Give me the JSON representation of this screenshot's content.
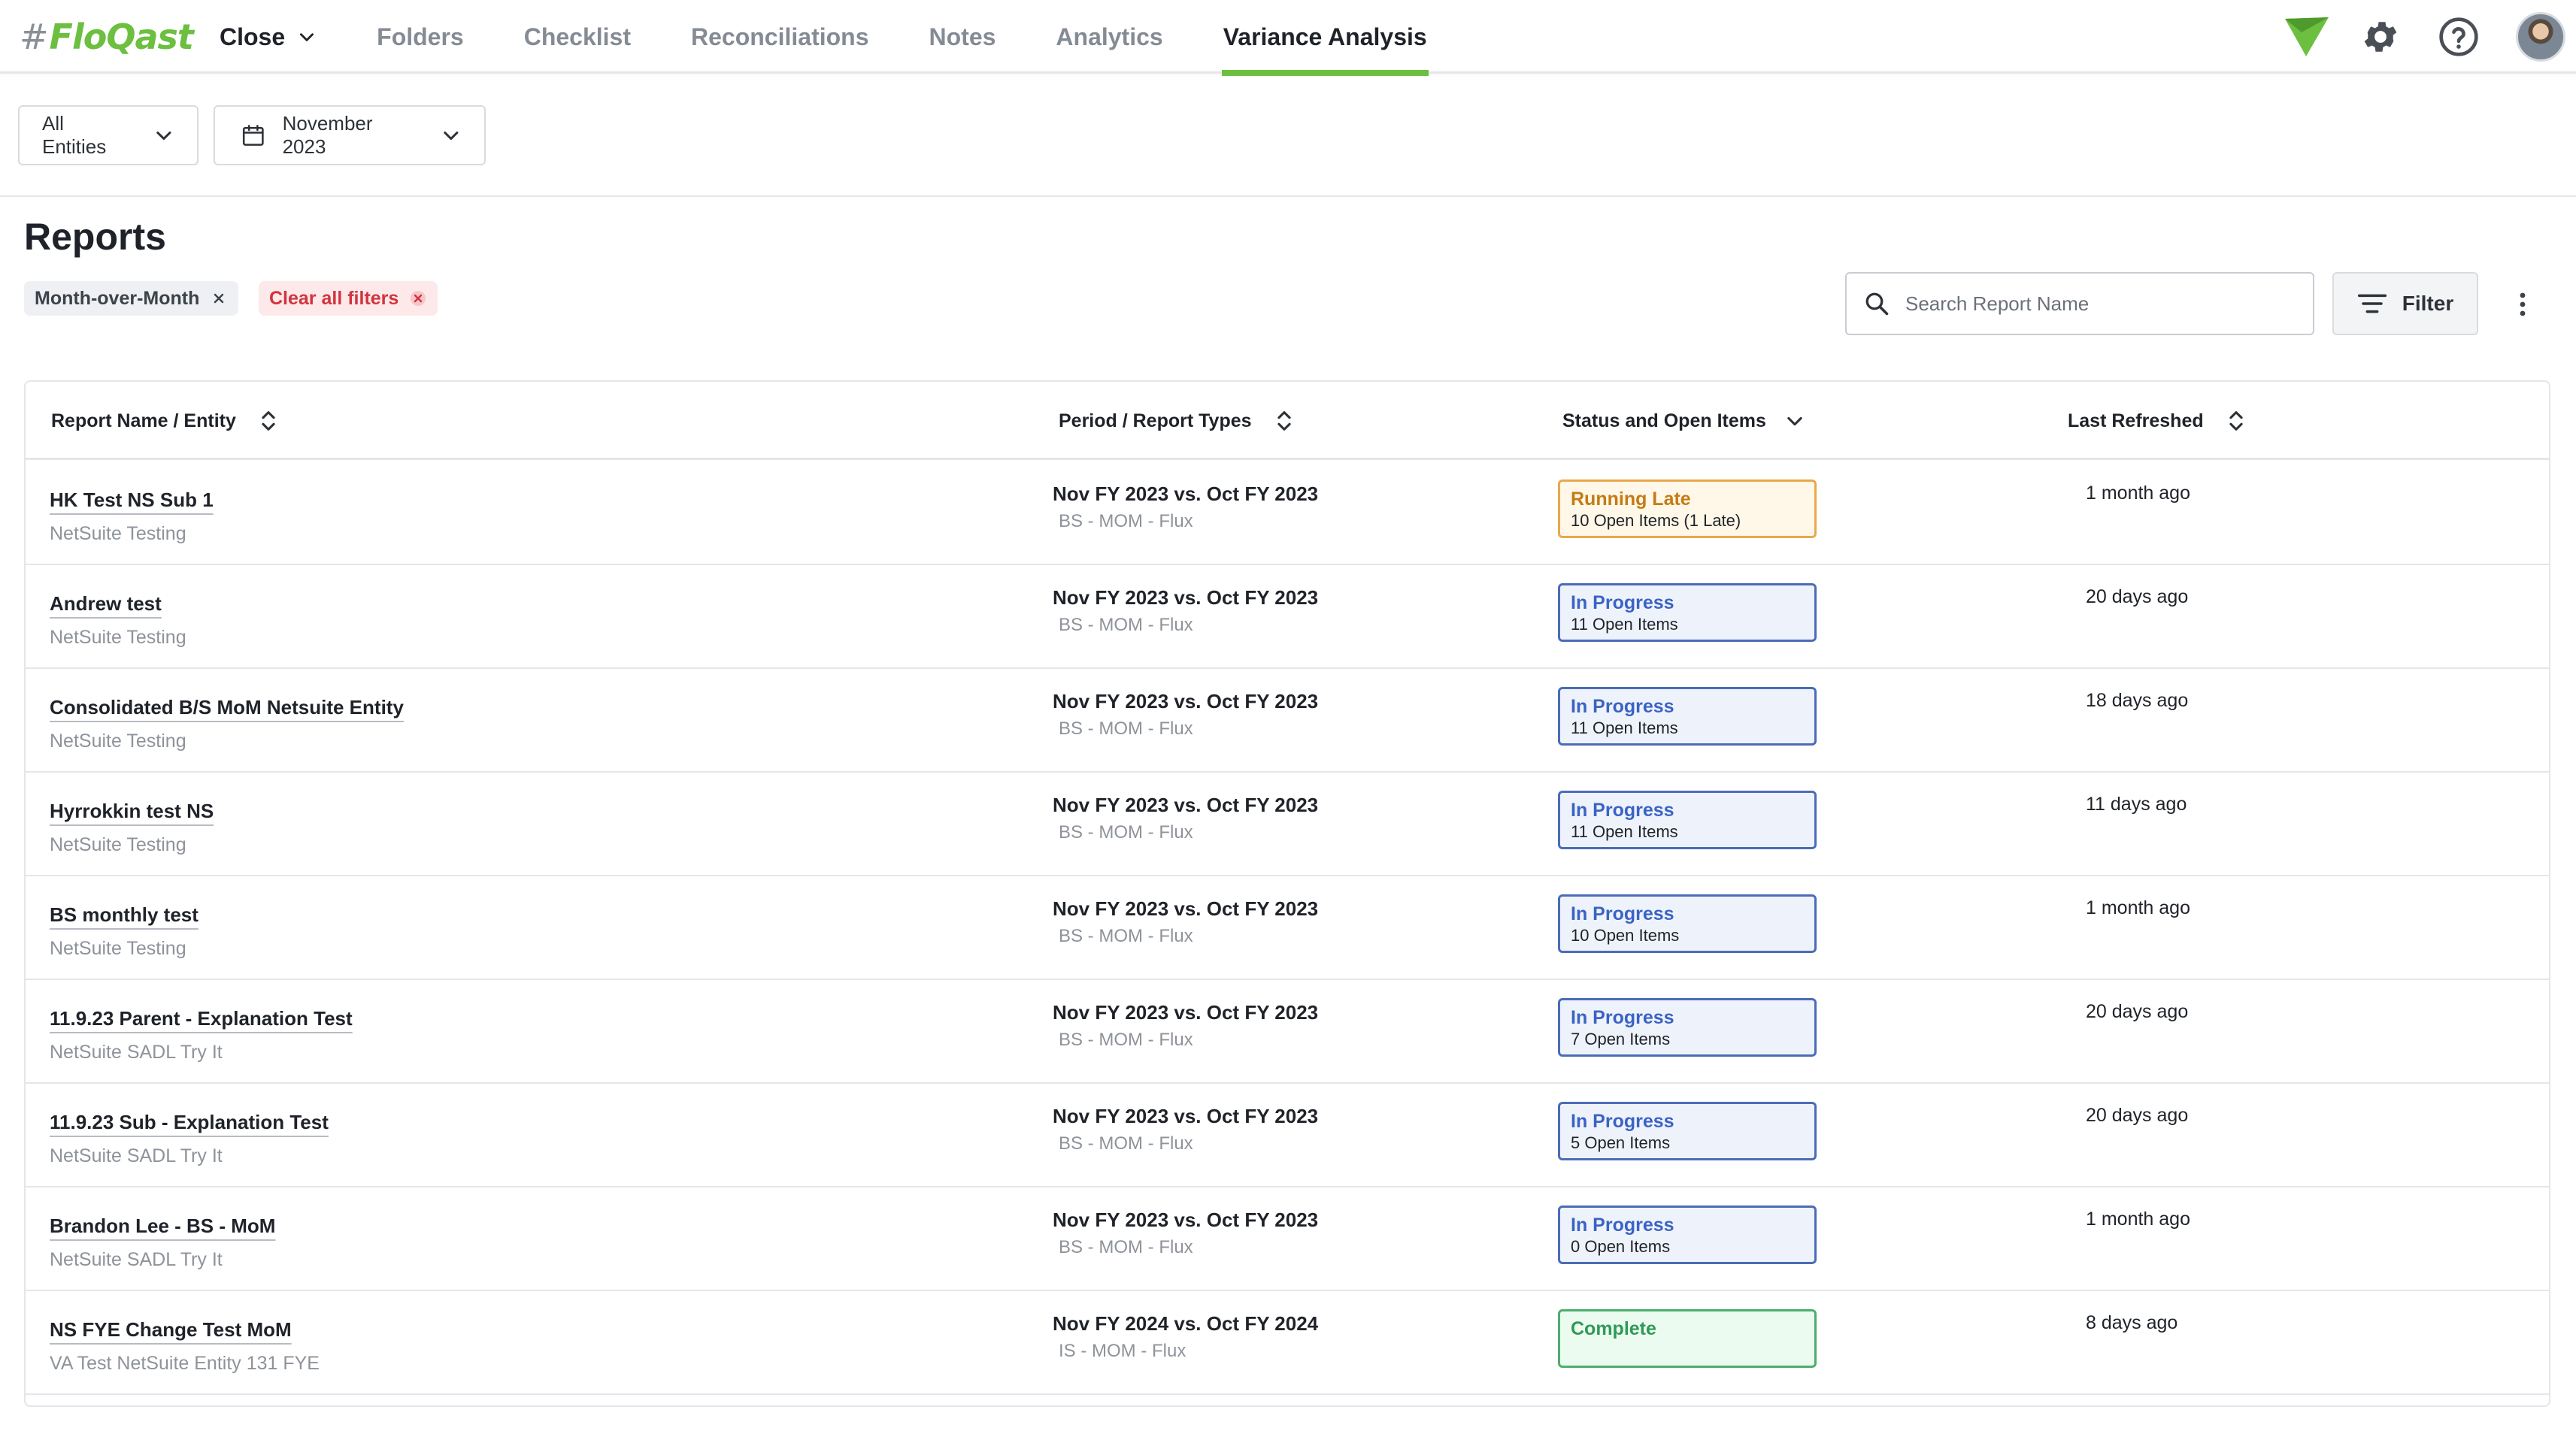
{
  "app": {
    "logo_text": "FloQast",
    "logo_hash": "#"
  },
  "nav": {
    "tabs": [
      {
        "label": "Close"
      },
      {
        "label": "Folders"
      },
      {
        "label": "Checklist"
      },
      {
        "label": "Reconciliations"
      },
      {
        "label": "Notes"
      },
      {
        "label": "Analytics"
      },
      {
        "label": "Variance Analysis"
      }
    ],
    "active_tab": "Variance Analysis",
    "right_icons": [
      "floqast-mark-icon",
      "gear-icon",
      "help-icon",
      "avatar"
    ]
  },
  "filters": {
    "entity_label": "All Entities",
    "period_label": "November 2023"
  },
  "page": {
    "title": "Reports",
    "chips": {
      "mom": "Month-over-Month",
      "clear": "Clear all filters"
    },
    "search_placeholder": "Search Report Name",
    "filter_label": "Filter"
  },
  "table": {
    "headers": {
      "name": "Report Name / Entity",
      "period": "Period / Report Types",
      "status": "Status and Open Items",
      "refreshed": "Last Refreshed"
    },
    "rows": [
      {
        "name": "HK Test NS Sub 1",
        "entity": "NetSuite Testing",
        "period": "Nov FY 2023 vs. Oct FY 2023",
        "types": "BS - MOM - Flux",
        "status": "Running Late",
        "status_kind": "running",
        "open_items": "10 Open Items (1 Late)",
        "refreshed": "1 month ago"
      },
      {
        "name": "Andrew test",
        "entity": "NetSuite Testing",
        "period": "Nov FY 2023 vs. Oct FY 2023",
        "types": "BS - MOM - Flux",
        "status": "In Progress",
        "status_kind": "progress",
        "open_items": "11 Open Items",
        "refreshed": "20 days ago"
      },
      {
        "name": "Consolidated B/S MoM Netsuite Entity",
        "entity": "NetSuite Testing",
        "period": "Nov FY 2023 vs. Oct FY 2023",
        "types": "BS - MOM - Flux",
        "status": "In Progress",
        "status_kind": "progress",
        "open_items": "11 Open Items",
        "refreshed": "18 days ago"
      },
      {
        "name": "Hyrrokkin test NS",
        "entity": "NetSuite Testing",
        "period": "Nov FY 2023 vs. Oct FY 2023",
        "types": "BS - MOM - Flux",
        "status": "In Progress",
        "status_kind": "progress",
        "open_items": "11 Open Items",
        "refreshed": "11 days ago"
      },
      {
        "name": "BS monthly test",
        "entity": "NetSuite Testing",
        "period": "Nov FY 2023 vs. Oct FY 2023",
        "types": "BS - MOM - Flux",
        "status": "In Progress",
        "status_kind": "progress",
        "open_items": "10 Open Items",
        "refreshed": "1 month ago"
      },
      {
        "name": "11.9.23 Parent - Explanation Test",
        "entity": "NetSuite SADL Try It",
        "period": "Nov FY 2023 vs. Oct FY 2023",
        "types": "BS - MOM - Flux",
        "status": "In Progress",
        "status_kind": "progress",
        "open_items": "7 Open Items",
        "refreshed": "20 days ago"
      },
      {
        "name": "11.9.23 Sub - Explanation Test",
        "entity": "NetSuite SADL Try It",
        "period": "Nov FY 2023 vs. Oct FY 2023",
        "types": "BS - MOM - Flux",
        "status": "In Progress",
        "status_kind": "progress",
        "open_items": "5 Open Items",
        "refreshed": "20 days ago"
      },
      {
        "name": "Brandon Lee - BS - MoM",
        "entity": "NetSuite SADL Try It",
        "period": "Nov FY 2023 vs. Oct FY 2023",
        "types": "BS - MOM - Flux",
        "status": "In Progress",
        "status_kind": "progress",
        "open_items": "0 Open Items",
        "refreshed": "1 month ago"
      },
      {
        "name": "NS FYE Change Test MoM",
        "entity": "VA Test NetSuite Entity 131 FYE",
        "period": "Nov FY 2024 vs. Oct FY 2024",
        "types": "IS - MOM - Flux",
        "status": "Complete",
        "status_kind": "complete",
        "open_items": "",
        "refreshed": "8 days ago"
      }
    ]
  },
  "colors": {
    "brand_green": "#6cbf3f",
    "running_late": "#e9a84c",
    "in_progress": "#4b6cb7",
    "complete": "#4cae6c",
    "danger": "#d1343f"
  }
}
